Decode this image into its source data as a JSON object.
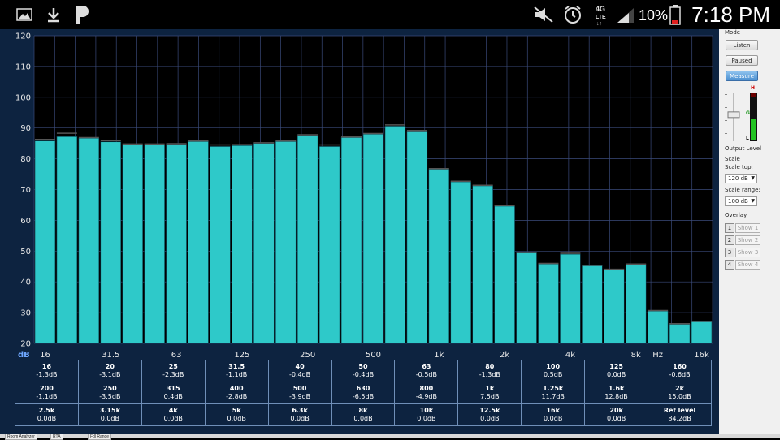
{
  "status_bar": {
    "time": "7:18 PM",
    "battery_percent": "10%",
    "network": "4G LTE",
    "icons": [
      "gallery-icon",
      "download-icon",
      "pandora-icon",
      "mute-icon",
      "alarm-icon",
      "lte-icon",
      "signal-icon",
      "battery-icon"
    ]
  },
  "chart_data": {
    "type": "bar",
    "ylabel": "dB",
    "ylim": [
      20,
      120
    ],
    "yticks": [
      20,
      30,
      40,
      50,
      60,
      70,
      80,
      90,
      100,
      110,
      120
    ],
    "x_tick_labels": [
      "16",
      "31.5",
      "63",
      "125",
      "250",
      "500",
      "1k",
      "2k",
      "4k",
      "8k",
      "16k"
    ],
    "x_unit": "Hz",
    "categories": [
      "16",
      "20",
      "25",
      "31.5",
      "40",
      "50",
      "63",
      "80",
      "100",
      "125",
      "160",
      "200",
      "250",
      "315",
      "400",
      "500",
      "630",
      "800",
      "1k",
      "1.25k",
      "1.6k",
      "2k",
      "2.5k",
      "3.15k",
      "4k",
      "5k",
      "6.3k",
      "8k",
      "10k",
      "12.5k",
      "16k"
    ],
    "values": [
      85.8,
      87.2,
      86.7,
      85.5,
      84.6,
      84.5,
      84.7,
      85.6,
      84.0,
      84.3,
      85.0,
      85.6,
      87.6,
      84.0,
      86.9,
      88.0,
      90.6,
      89.0,
      76.6,
      72.5,
      71.2,
      64.6,
      49.4,
      45.8,
      49.0,
      45.2,
      43.9,
      45.6,
      30.5,
      26.2,
      27.0,
      26.0
    ],
    "peak_values": [
      86.3,
      88.3,
      86.9,
      85.9,
      84.8,
      84.8,
      84.9,
      85.8,
      84.5,
      84.6,
      85.2,
      85.8,
      87.8,
      84.5,
      87.1,
      88.2,
      91.0,
      89.2,
      76.8,
      72.7,
      71.4,
      64.8,
      49.6,
      46.0,
      49.3,
      45.4,
      44.1,
      45.8,
      30.7,
      26.4,
      27.2,
      26.2
    ],
    "bar_color": "#2ec9c9",
    "grid": true,
    "background": "#000000"
  },
  "band_table": [
    [
      {
        "f": "16",
        "v": "-1.3dB"
      },
      {
        "f": "20",
        "v": "-3.1dB"
      },
      {
        "f": "25",
        "v": "-2.3dB"
      },
      {
        "f": "31.5",
        "v": "-1.1dB"
      },
      {
        "f": "40",
        "v": "-0.4dB"
      },
      {
        "f": "50",
        "v": "-0.4dB"
      },
      {
        "f": "63",
        "v": "-0.5dB"
      },
      {
        "f": "80",
        "v": "-1.3dB"
      },
      {
        "f": "100",
        "v": "0.5dB"
      },
      {
        "f": "125",
        "v": "0.0dB"
      },
      {
        "f": "160",
        "v": "-0.6dB"
      }
    ],
    [
      {
        "f": "200",
        "v": "-1.1dB"
      },
      {
        "f": "250",
        "v": "-3.5dB"
      },
      {
        "f": "315",
        "v": "0.4dB"
      },
      {
        "f": "400",
        "v": "-2.8dB"
      },
      {
        "f": "500",
        "v": "-3.9dB"
      },
      {
        "f": "630",
        "v": "-6.5dB"
      },
      {
        "f": "800",
        "v": "-4.9dB"
      },
      {
        "f": "1k",
        "v": "7.5dB"
      },
      {
        "f": "1.25k",
        "v": "11.7dB"
      },
      {
        "f": "1.6k",
        "v": "12.8dB"
      },
      {
        "f": "2k",
        "v": "15.0dB"
      }
    ],
    [
      {
        "f": "2.5k",
        "v": "0.0dB"
      },
      {
        "f": "3.15k",
        "v": "0.0dB"
      },
      {
        "f": "4k",
        "v": "0.0dB"
      },
      {
        "f": "5k",
        "v": "0.0dB"
      },
      {
        "f": "6.3k",
        "v": "0.0dB"
      },
      {
        "f": "8k",
        "v": "0.0dB"
      },
      {
        "f": "10k",
        "v": "0.0dB"
      },
      {
        "f": "12.5k",
        "v": "0.0dB"
      },
      {
        "f": "16k",
        "v": "0.0dB"
      },
      {
        "f": "20k",
        "v": "0.0dB"
      },
      {
        "f": "Ref level",
        "v": "84.2dB"
      }
    ]
  ],
  "right_panel": {
    "mode_label": "Mode",
    "listen_label": "Listen",
    "paused_label": "Paused",
    "measure_label": "Measure",
    "meter_h": "H",
    "meter_g": "G",
    "meter_l": "L",
    "output_level_label": "Output Level",
    "output_level_fraction": 0.55,
    "meter_level_fraction": 0.45,
    "scale_label": "Scale",
    "scale_top_label": "Scale top:",
    "scale_top_value": "120 dB",
    "scale_range_label": "Scale range:",
    "scale_range_value": "100 dB",
    "overlay_label": "Overlay",
    "overlays": [
      {
        "num": "1",
        "label": "Show 1"
      },
      {
        "num": "2",
        "label": "Show 2"
      },
      {
        "num": "3",
        "label": "Show 3"
      },
      {
        "num": "4",
        "label": "Show 4"
      }
    ]
  },
  "bottom_tabs": [
    "Room Analyzer",
    "RTA",
    "Fdl Range"
  ]
}
